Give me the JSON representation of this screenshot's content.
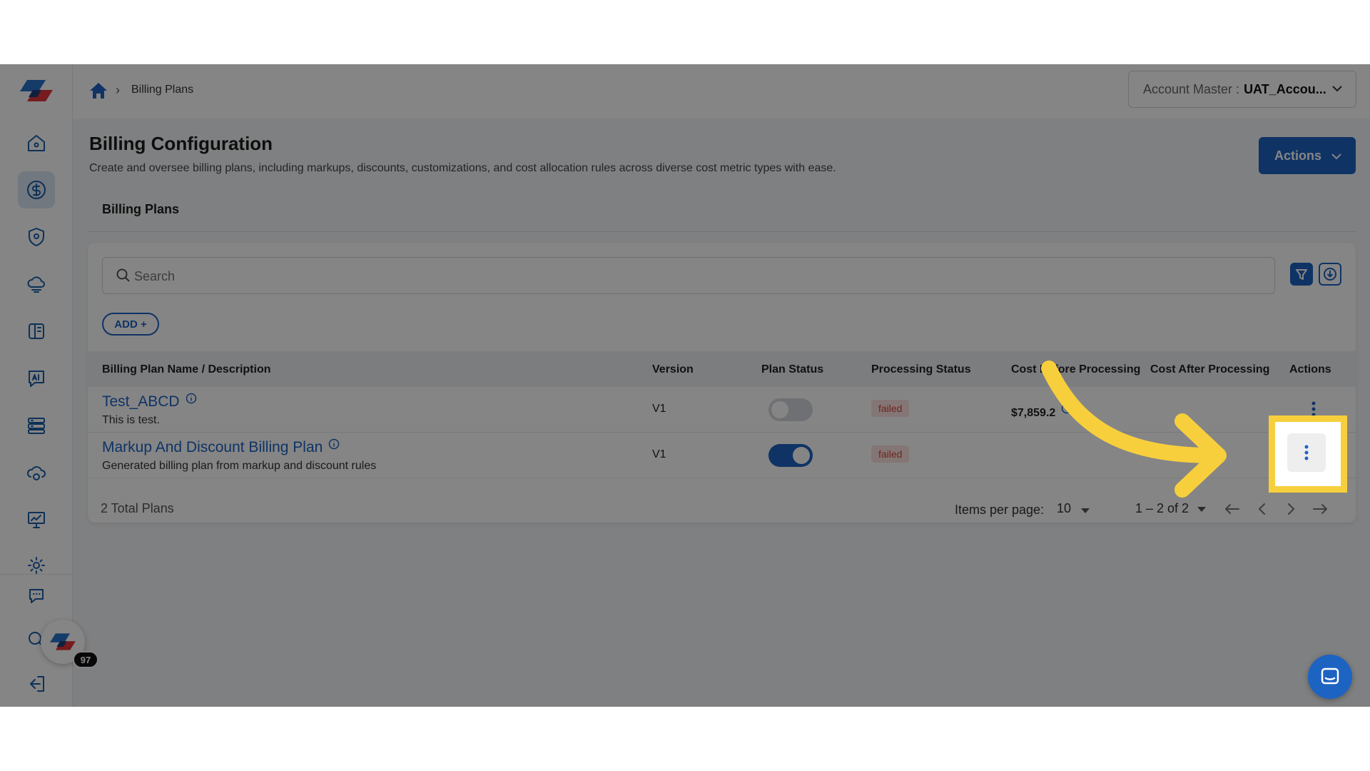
{
  "breadcrumb": {
    "current": "Billing Plans"
  },
  "account": {
    "label": "Account Master :",
    "value": "UAT_Accou..."
  },
  "header": {
    "title": "Billing Configuration",
    "description": "Create and oversee billing plans, including markups, discounts, customizations, and cost allocation rules across diverse cost metric types with ease.",
    "actions_label": "Actions"
  },
  "tabs": {
    "billing_plans": "Billing Plans"
  },
  "search": {
    "placeholder": "Search"
  },
  "add_label": "ADD +",
  "table": {
    "columns": [
      "Billing Plan Name / Description",
      "Version",
      "Plan Status",
      "Processing Status",
      "Cost Before Processing",
      "Cost After Processing",
      "Actions"
    ],
    "rows": [
      {
        "name": "Test_ABCD",
        "description": "This is test.",
        "version": "V1",
        "plan_status": "off",
        "processing_status": "failed",
        "cost_before": "$7,859.2",
        "cost_after": ""
      },
      {
        "name": "Markup And Discount Billing Plan",
        "description": "Generated billing plan from markup and discount rules",
        "version": "V1",
        "plan_status": "on",
        "processing_status": "failed",
        "cost_before": "",
        "cost_after": ""
      }
    ]
  },
  "footer": {
    "total": "2 Total Plans",
    "items_per_page_label": "Items per page:",
    "items_per_page": "10",
    "range": "1 – 2 of 2"
  },
  "badge_count": "97",
  "colors": {
    "accent": "#1d63c2",
    "highlight": "#f7cf3c",
    "failed_bg": "#fde3e1",
    "failed_text": "#d2473a"
  },
  "icons": [
    "home-icon",
    "dollar-icon",
    "shield-icon",
    "cloud-icon",
    "book-icon",
    "ai-chat-icon",
    "server-icon",
    "cloud-gear-icon",
    "presentation-icon",
    "settings-icon",
    "support-icon",
    "user-search-icon",
    "logout-icon"
  ]
}
